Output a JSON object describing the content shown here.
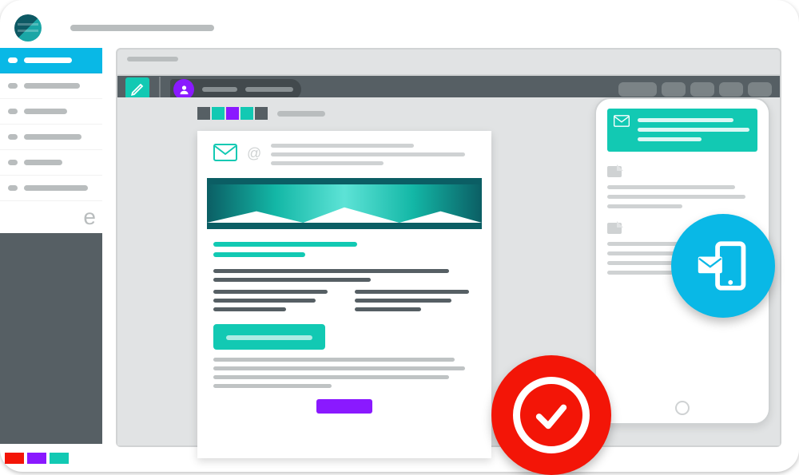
{
  "colors": {
    "teal": "#12c9b3",
    "purple": "#8a19ff",
    "cyan": "#09b8e6",
    "red": "#f31507",
    "dark": "#565f64",
    "grey": "#b9bdbe"
  },
  "sidebar": {
    "items": [
      {
        "kind": "active"
      },
      {
        "kind": "light"
      },
      {
        "kind": "light"
      },
      {
        "kind": "light"
      },
      {
        "kind": "light"
      },
      {
        "kind": "light"
      }
    ],
    "cutoff_letter": "e"
  },
  "footer_swatches": [
    "#f31507",
    "#8a19ff",
    "#12c9b3"
  ],
  "editor": {
    "palette": [
      "#565f64",
      "#12c9b3",
      "#8a19ff",
      "#12c9b3",
      "#565f64"
    ],
    "toolbar": {
      "edit_icon": "pencil-icon",
      "user_icon": "user-icon",
      "right_slots": 5
    }
  },
  "email_preview": {
    "header_icon": "mail-icon",
    "at_symbol": "@",
    "cta_present": true,
    "footer_button_color": "#8a19ff"
  },
  "mobile_preview": {
    "card_icon": "mail-icon",
    "sections": 2
  },
  "badges": {
    "red": "check-icon",
    "blue": "mail-phone-icon"
  }
}
